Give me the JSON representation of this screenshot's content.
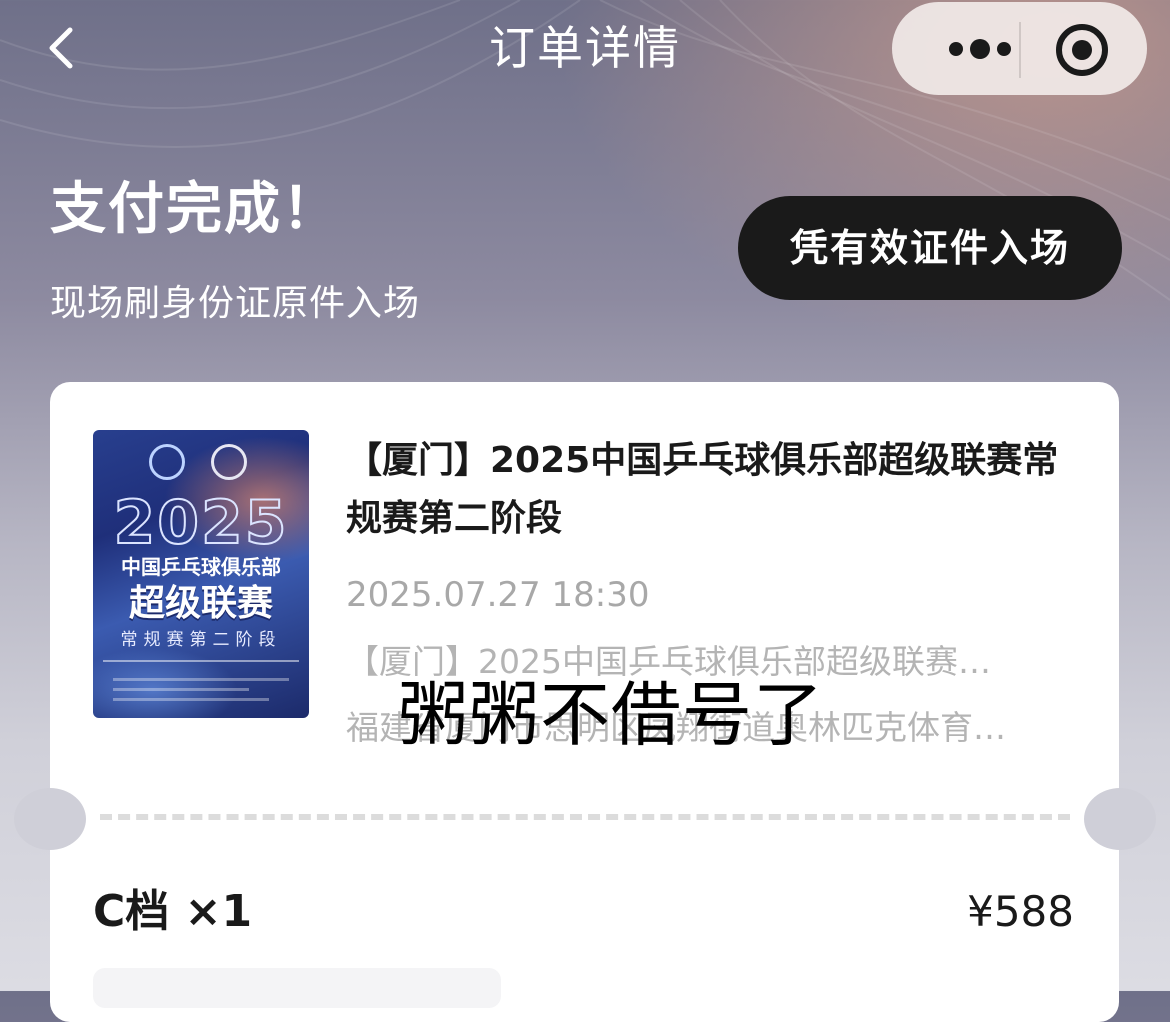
{
  "nav": {
    "title": "订单详情",
    "back_icon": "chevron-left-icon",
    "more_icon": "more-dots-icon",
    "close_icon": "target-icon"
  },
  "status": {
    "title": "支付完成！",
    "subtitle": "现场刷身份证原件入场",
    "entry_badge": "凭有效证件入场"
  },
  "event": {
    "title": "【厦门】2025中国乒乓球俱乐部超级联赛常规赛第二阶段",
    "datetime": "2025.07.27 18:30",
    "description": "【厦门】2025中国乒乓球俱乐部超级联赛…",
    "venue": "福建省厦门市思明区凤翔街道奥林匹克体育…",
    "poster": {
      "year": "2025",
      "line1": "中国乒乓球俱乐部",
      "line2": "超级联赛",
      "line3": "常规赛第二阶段"
    }
  },
  "overlay": {
    "text": "粥粥不借号了"
  },
  "ticket": {
    "tier": "C档 ×1",
    "price": "¥588"
  },
  "colors": {
    "pill_bg": "#1a1a1a",
    "card_bg": "#ffffff",
    "muted_text": "#a8a8a8"
  }
}
